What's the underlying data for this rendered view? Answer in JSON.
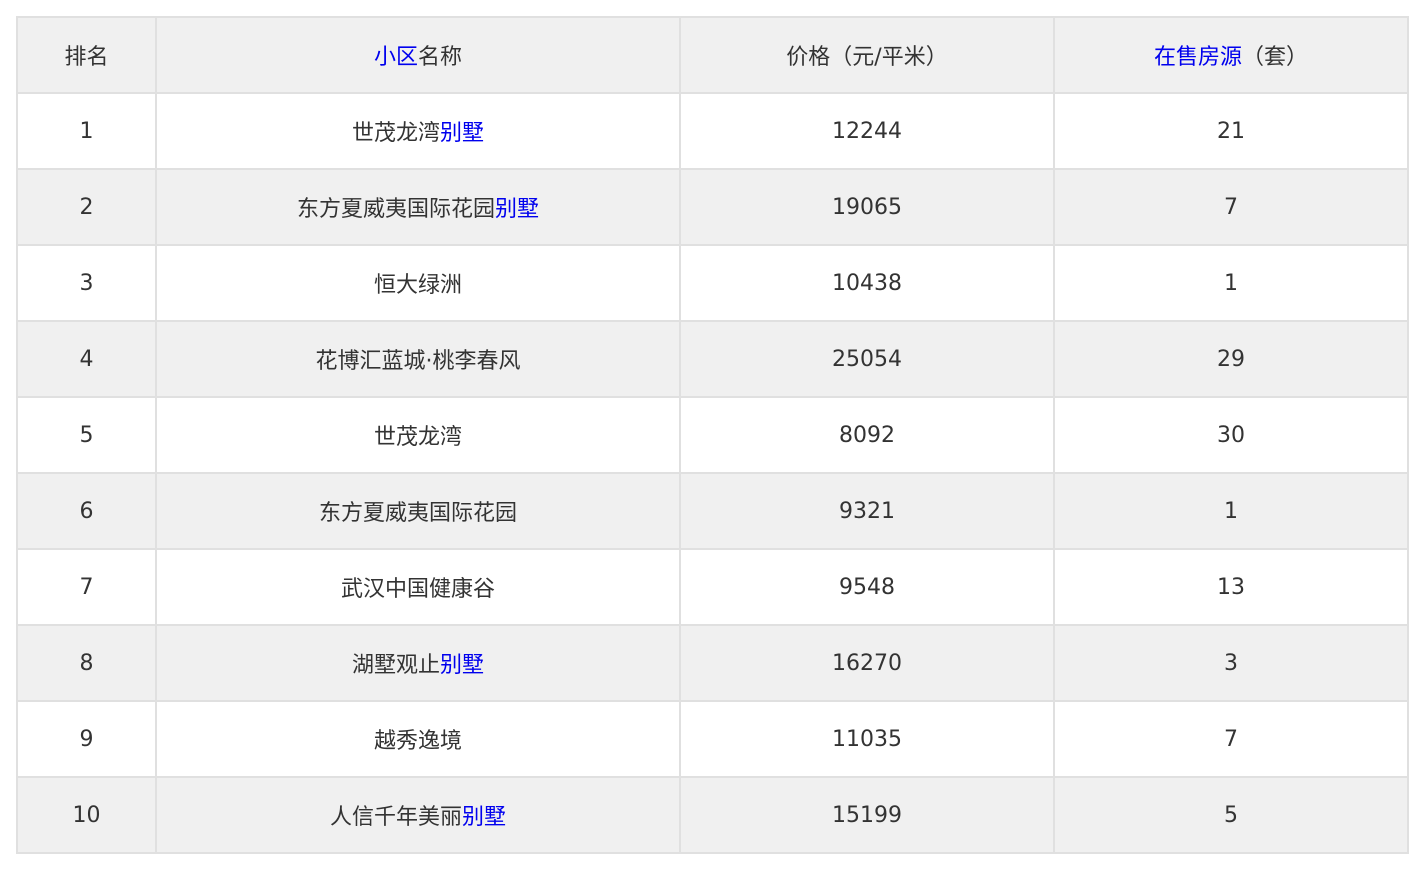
{
  "table": {
    "header": {
      "rank": "排名",
      "name_link": "小区",
      "name_suffix": "名称",
      "price": "价格（元/平米）",
      "listings_link": "在售房源",
      "listings_suffix": "（套）"
    },
    "rows": [
      {
        "rank": "1",
        "name": "世茂龙湾",
        "name_link": "别墅",
        "price": "12244",
        "count": "21"
      },
      {
        "rank": "2",
        "name": "东方夏威夷国际花园",
        "name_link": "别墅",
        "price": "19065",
        "count": "7"
      },
      {
        "rank": "3",
        "name": "恒大绿洲",
        "name_link": "",
        "price": "10438",
        "count": "1"
      },
      {
        "rank": "4",
        "name": "花博汇蓝城·桃李春风",
        "name_link": "",
        "price": "25054",
        "count": "29"
      },
      {
        "rank": "5",
        "name": "世茂龙湾",
        "name_link": "",
        "price": "8092",
        "count": "30"
      },
      {
        "rank": "6",
        "name": "东方夏威夷国际花园",
        "name_link": "",
        "price": "9321",
        "count": "1"
      },
      {
        "rank": "7",
        "name": "武汉中国健康谷",
        "name_link": "",
        "price": "9548",
        "count": "13"
      },
      {
        "rank": "8",
        "name": "湖墅观止",
        "name_link": "别墅",
        "price": "16270",
        "count": "3"
      },
      {
        "rank": "9",
        "name": "越秀逸境",
        "name_link": "",
        "price": "11035",
        "count": "7"
      },
      {
        "rank": "10",
        "name": "人信千年美丽",
        "name_link": "别墅",
        "price": "15199",
        "count": "5"
      }
    ]
  },
  "colors": {
    "link": "#0000ee",
    "shaded_row": "#f0f0f0",
    "border": "#e0e0e0",
    "text": "#333333"
  }
}
